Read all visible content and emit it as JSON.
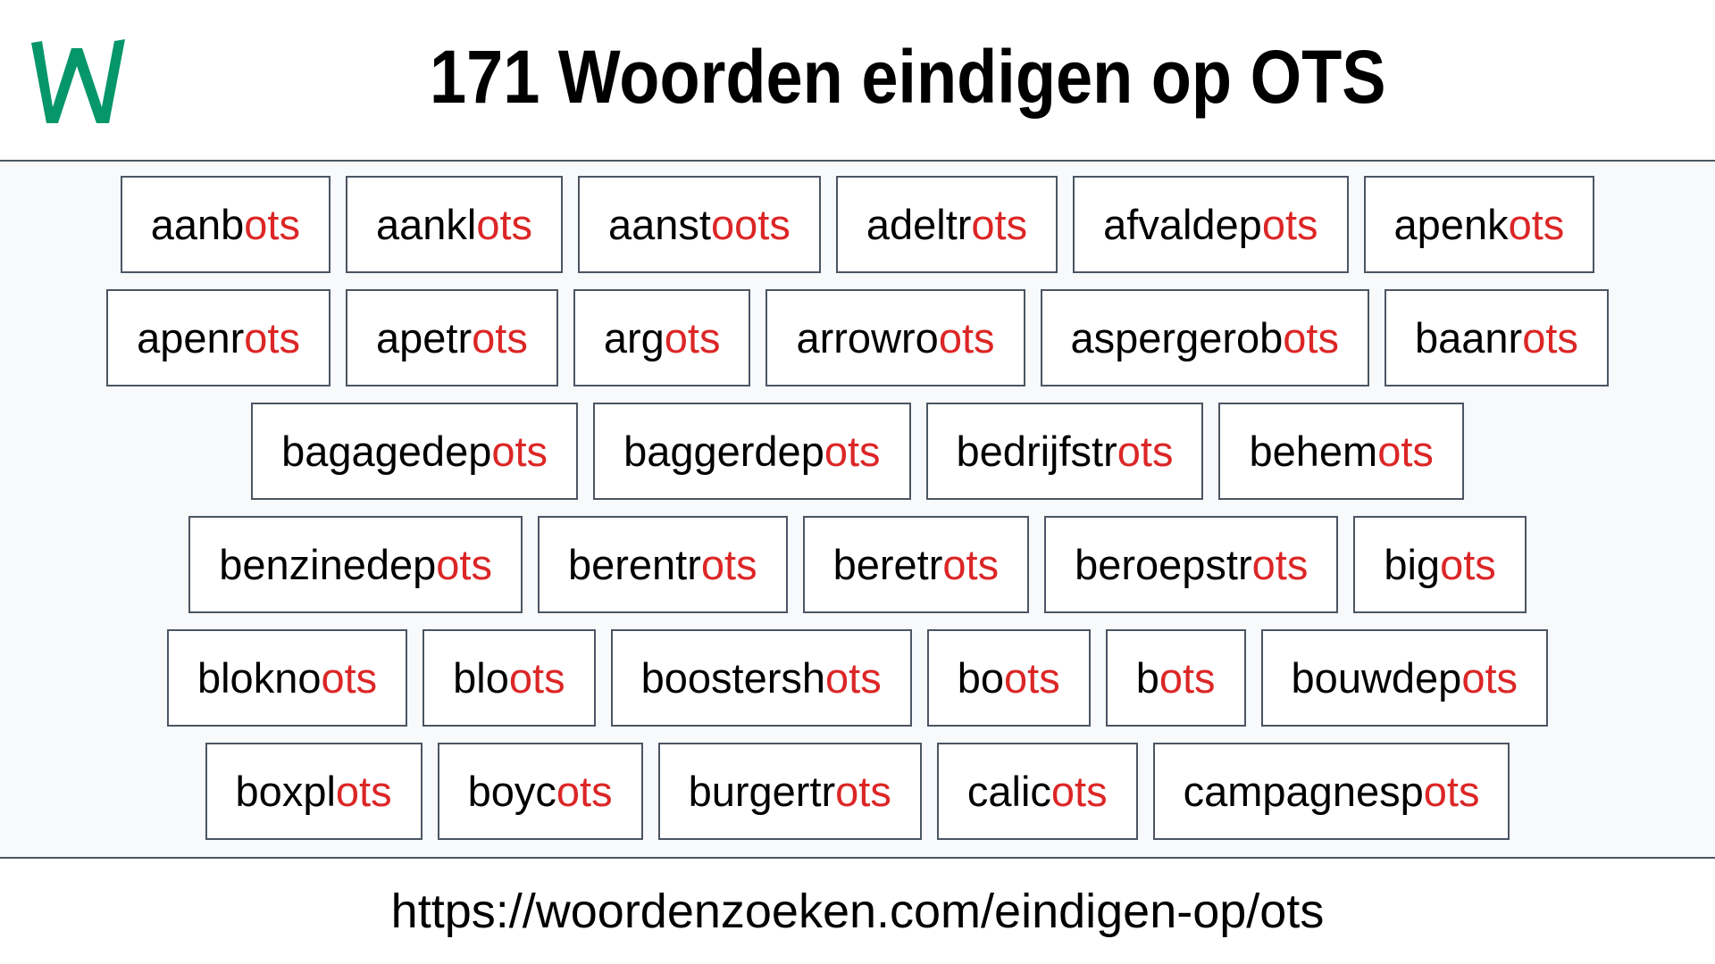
{
  "header": {
    "logo_icon": "w-logo-icon",
    "logo_letter": "W",
    "title": "171 Woorden eindigen op OTS"
  },
  "colors": {
    "brand_green": "#059669",
    "suffix_red": "#dc2626",
    "border": "#4b5563",
    "background": "#f8f9fb"
  },
  "suffix": "ots",
  "rows": [
    [
      {
        "prefix": "aanb",
        "suffix": "ots"
      },
      {
        "prefix": "aankl",
        "suffix": "ots"
      },
      {
        "prefix": "aanst",
        "suffix": "oots"
      },
      {
        "prefix": "adeltr",
        "suffix": "ots"
      },
      {
        "prefix": "afvaldep",
        "suffix": "ots"
      },
      {
        "prefix": "apenk",
        "suffix": "ots"
      }
    ],
    [
      {
        "prefix": "apenr",
        "suffix": "ots"
      },
      {
        "prefix": "apetr",
        "suffix": "ots"
      },
      {
        "prefix": "arg",
        "suffix": "ots"
      },
      {
        "prefix": "arrowro",
        "suffix": "ots"
      },
      {
        "prefix": "aspergerob",
        "suffix": "ots"
      },
      {
        "prefix": "baanr",
        "suffix": "ots"
      }
    ],
    [
      {
        "prefix": "bagagedep",
        "suffix": "ots"
      },
      {
        "prefix": "baggerdep",
        "suffix": "ots"
      },
      {
        "prefix": "bedrijfstr",
        "suffix": "ots"
      },
      {
        "prefix": "behem",
        "suffix": "ots"
      }
    ],
    [
      {
        "prefix": "benzinedep",
        "suffix": "ots"
      },
      {
        "prefix": "berentr",
        "suffix": "ots"
      },
      {
        "prefix": "beretr",
        "suffix": "ots"
      },
      {
        "prefix": "beroepstr",
        "suffix": "ots"
      },
      {
        "prefix": "big",
        "suffix": "ots"
      }
    ],
    [
      {
        "prefix": "blokno",
        "suffix": "ots"
      },
      {
        "prefix": "blo",
        "suffix": "ots"
      },
      {
        "prefix": "boostersh",
        "suffix": "ots"
      },
      {
        "prefix": "bo",
        "suffix": "ots"
      },
      {
        "prefix": "b",
        "suffix": "ots"
      },
      {
        "prefix": "bouwdep",
        "suffix": "ots"
      }
    ],
    [
      {
        "prefix": "boxpl",
        "suffix": "ots"
      },
      {
        "prefix": "boyc",
        "suffix": "ots"
      },
      {
        "prefix": "burgertr",
        "suffix": "ots"
      },
      {
        "prefix": "calic",
        "suffix": "ots"
      },
      {
        "prefix": "campagnesp",
        "suffix": "ots"
      }
    ]
  ],
  "footer": {
    "url": "https://woordenzoeken.com/eindigen-op/ots"
  }
}
